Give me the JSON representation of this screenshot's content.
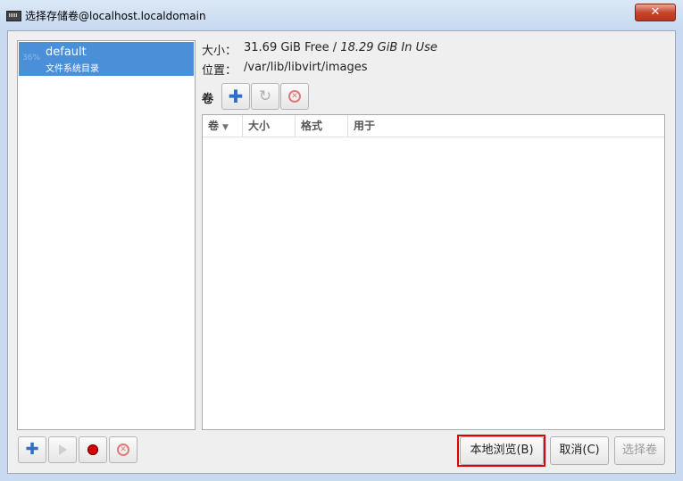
{
  "window": {
    "title": "选择存储卷@localhost.localdomain",
    "close_label": "✕"
  },
  "pools": [
    {
      "usage": "36%",
      "name": "default",
      "type": "文件系统目录"
    }
  ],
  "pool_info": {
    "size_label": "大小：",
    "size_free": "31.69 GiB Free",
    "size_sep": " / ",
    "size_in_use": "18.29 GiB In Use",
    "location_label": "位置：",
    "location_value": "/var/lib/libvirt/images"
  },
  "volumes": {
    "section_label": "卷",
    "toolbar": {
      "add_icon": "plus-icon",
      "refresh_icon": "refresh-icon",
      "delete_icon": "delete-icon"
    },
    "columns": [
      "卷",
      "大小",
      "格式",
      "用于"
    ],
    "rows": []
  },
  "pool_toolbar": {
    "add_icon": "plus-icon",
    "start_icon": "play-icon",
    "stop_icon": "record-icon",
    "delete_icon": "delete-icon"
  },
  "buttons": {
    "browse_local": "本地浏览(B)",
    "cancel": "取消(C)",
    "choose_volume": "选择卷"
  },
  "colors": {
    "selection": "#4a90d9",
    "highlight_border": "#e00000",
    "add_icon": "#2f6fc5",
    "stop_icon": "#d10000"
  }
}
